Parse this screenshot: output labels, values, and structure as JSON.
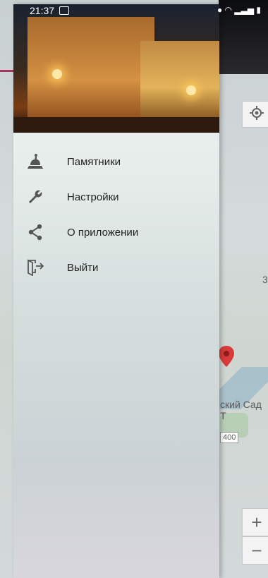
{
  "status_bar": {
    "time": "21:37"
  },
  "map": {
    "place_label": "ский Сад Т",
    "letter_label": "3",
    "road_label": "400",
    "zoom_in": "+",
    "zoom_out": "−"
  },
  "menu": {
    "items": [
      {
        "label": "Памятники",
        "icon": "monument-icon"
      },
      {
        "label": "Настройки",
        "icon": "wrench-icon"
      },
      {
        "label": "О приложении",
        "icon": "share-icon"
      },
      {
        "label": "Выйти",
        "icon": "exit-icon"
      }
    ]
  }
}
